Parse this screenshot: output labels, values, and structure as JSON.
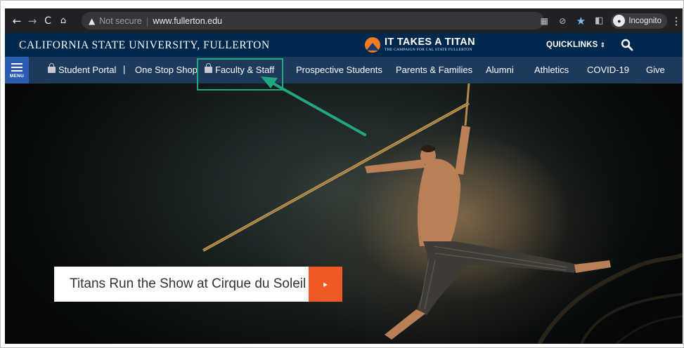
{
  "browser": {
    "back_icon": "back-arrow-icon",
    "forward_icon": "forward-arrow-icon",
    "reload_icon": "reload-icon",
    "home_icon": "home-icon",
    "security_label": "Not secure",
    "url": "www.fullerton.edu",
    "incognito_label": "Incognito"
  },
  "site": {
    "university_name": "CALIFORNIA STATE UNIVERSITY, FULLERTON",
    "campaign_title": "IT TAKES A TITAN",
    "campaign_subtitle": "THE CAMPAIGN FOR CAL STATE FULLERTON",
    "quicklinks_label": "QUICKLINKS"
  },
  "nav": {
    "menu_label": "MENU",
    "items": [
      {
        "label": "Student Portal",
        "locked": true
      },
      {
        "label": "One Stop Shop",
        "locked": false
      },
      {
        "label": "Faculty & Staff",
        "locked": true
      },
      {
        "label": "Prospective Students",
        "locked": false
      },
      {
        "label": "Parents & Families",
        "locked": false
      },
      {
        "label": "Alumni",
        "locked": false
      },
      {
        "label": "Athletics",
        "locked": false
      },
      {
        "label": "COVID-19",
        "locked": false
      },
      {
        "label": "Give",
        "locked": false
      }
    ]
  },
  "hero": {
    "caption": "Titans Run the Show at Cirque du Soleil",
    "cta_icon": "play-arrow-icon"
  },
  "colors": {
    "header_bg": "#00274c",
    "nav_bg": "#1d3a5c",
    "menu_btn_bg": "#2a5db0",
    "accent_orange": "#ee5a24",
    "annotation_green": "#21a883"
  }
}
